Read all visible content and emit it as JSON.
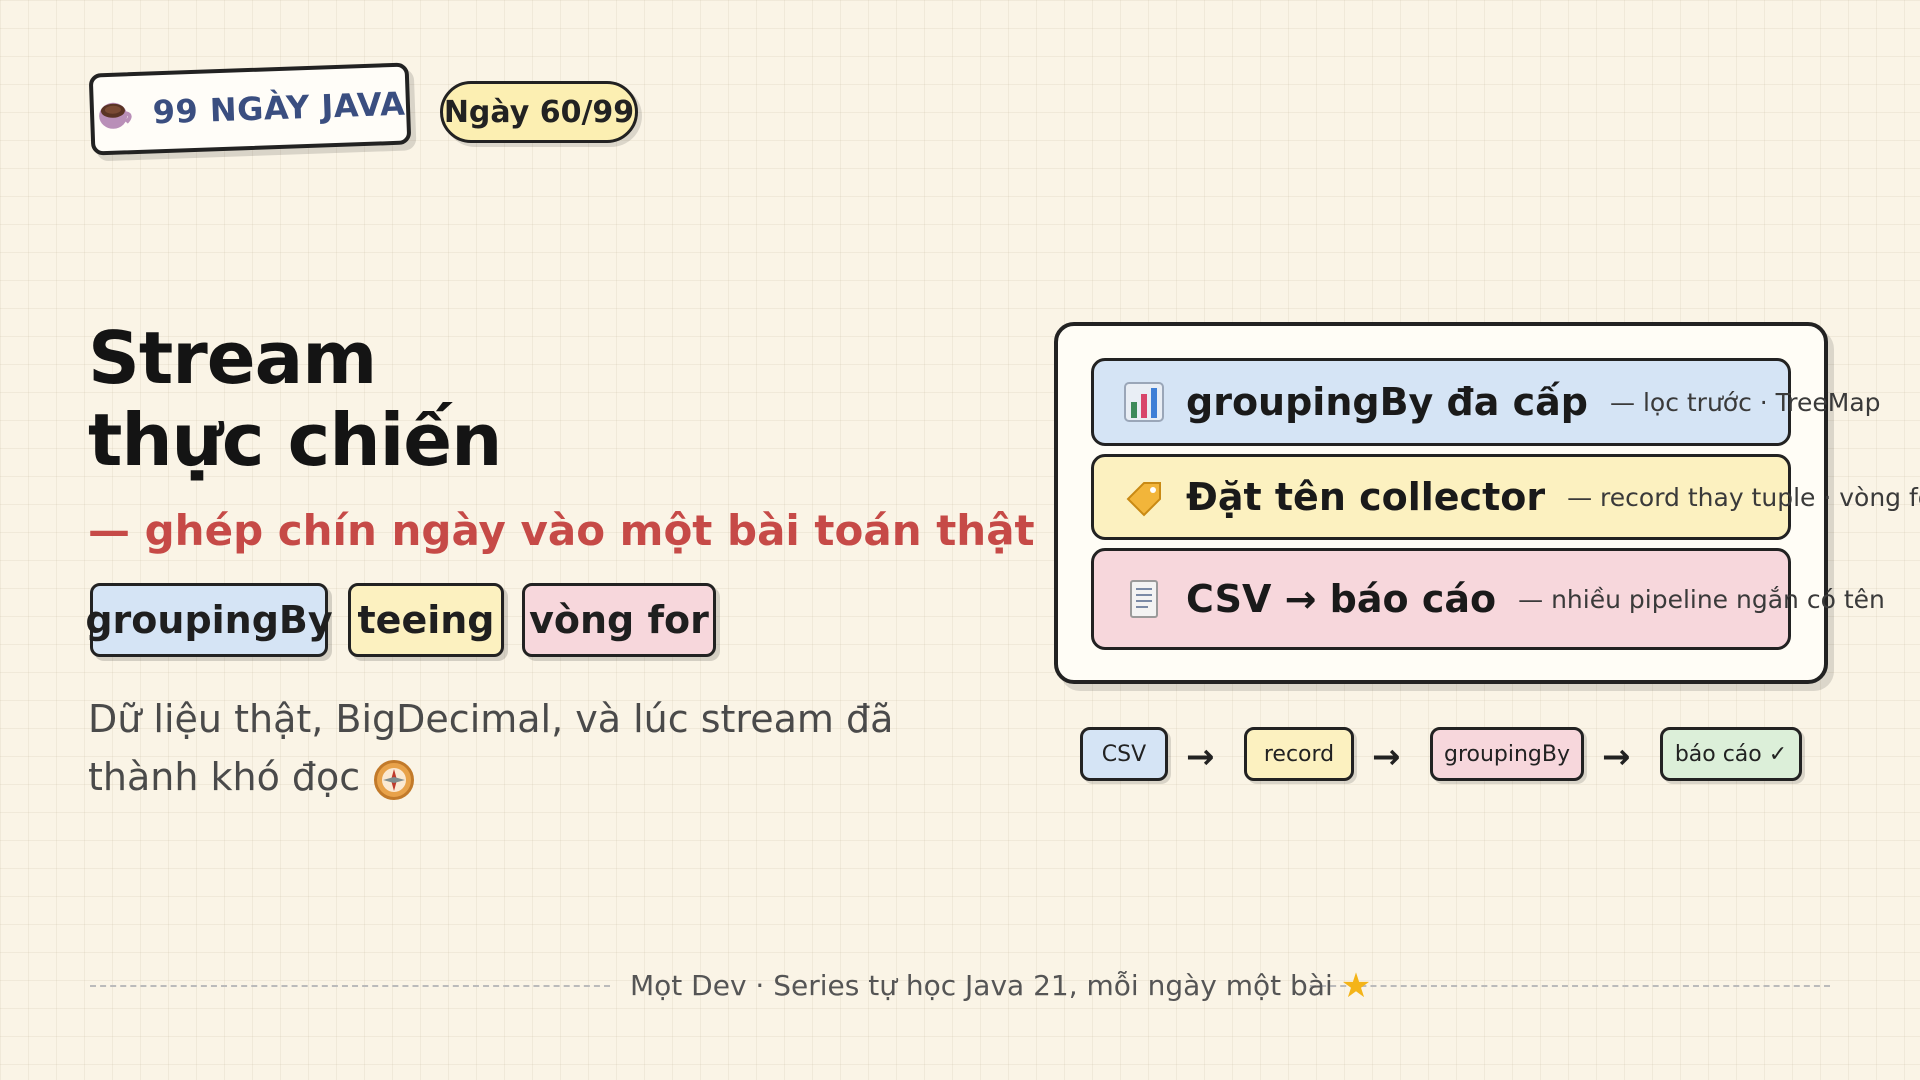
{
  "brand": {
    "label": "99 NGÀY JAVA",
    "icon": "coffee-cup-icon"
  },
  "day_badge": "Ngày 60/99",
  "title": {
    "line1": "Stream",
    "line2": "thực chiến"
  },
  "subtitle": {
    "text": "— ghép chín ngày vào một bài toán thật",
    "icon": "bar-chart-icon"
  },
  "tags": [
    {
      "label": "groupingBy",
      "color": "#d5e4f5"
    },
    {
      "label": "teeing",
      "color": "#fcf1c0"
    },
    {
      "label": "vòng for",
      "color": "#f7d7dc"
    }
  ],
  "description": {
    "text": "Dữ liệu thật, BigDecimal, và lúc stream đã thành khó đọc",
    "icon": "compass-icon"
  },
  "cards": [
    {
      "title": "groupingBy đa cấp",
      "desc": "— lọc trước · TreeMap",
      "icon": "bar-chart-icon",
      "color": "#d5e4f5"
    },
    {
      "title": "Đặt tên collector",
      "desc": "— record thay tuple · vòng for",
      "icon": "tag-icon",
      "color": "#fcf1c0"
    },
    {
      "title": "CSV → báo cáo",
      "desc": "— nhiều pipeline ngắn có tên",
      "icon": "document-icon",
      "color": "#f7d7dc"
    }
  ],
  "flow": [
    {
      "label": "CSV",
      "color": "#d5e4f5"
    },
    {
      "label": "record",
      "color": "#fcf1c0"
    },
    {
      "label": "groupingBy",
      "color": "#f7d7dc"
    },
    {
      "label": "báo cáo ✓",
      "color": "#dcefd9"
    }
  ],
  "flow_arrow": "→",
  "footer": {
    "text": "Mọt Dev · Series tự học Java 21, mỗi ngày một bài",
    "icon": "star-icon"
  }
}
